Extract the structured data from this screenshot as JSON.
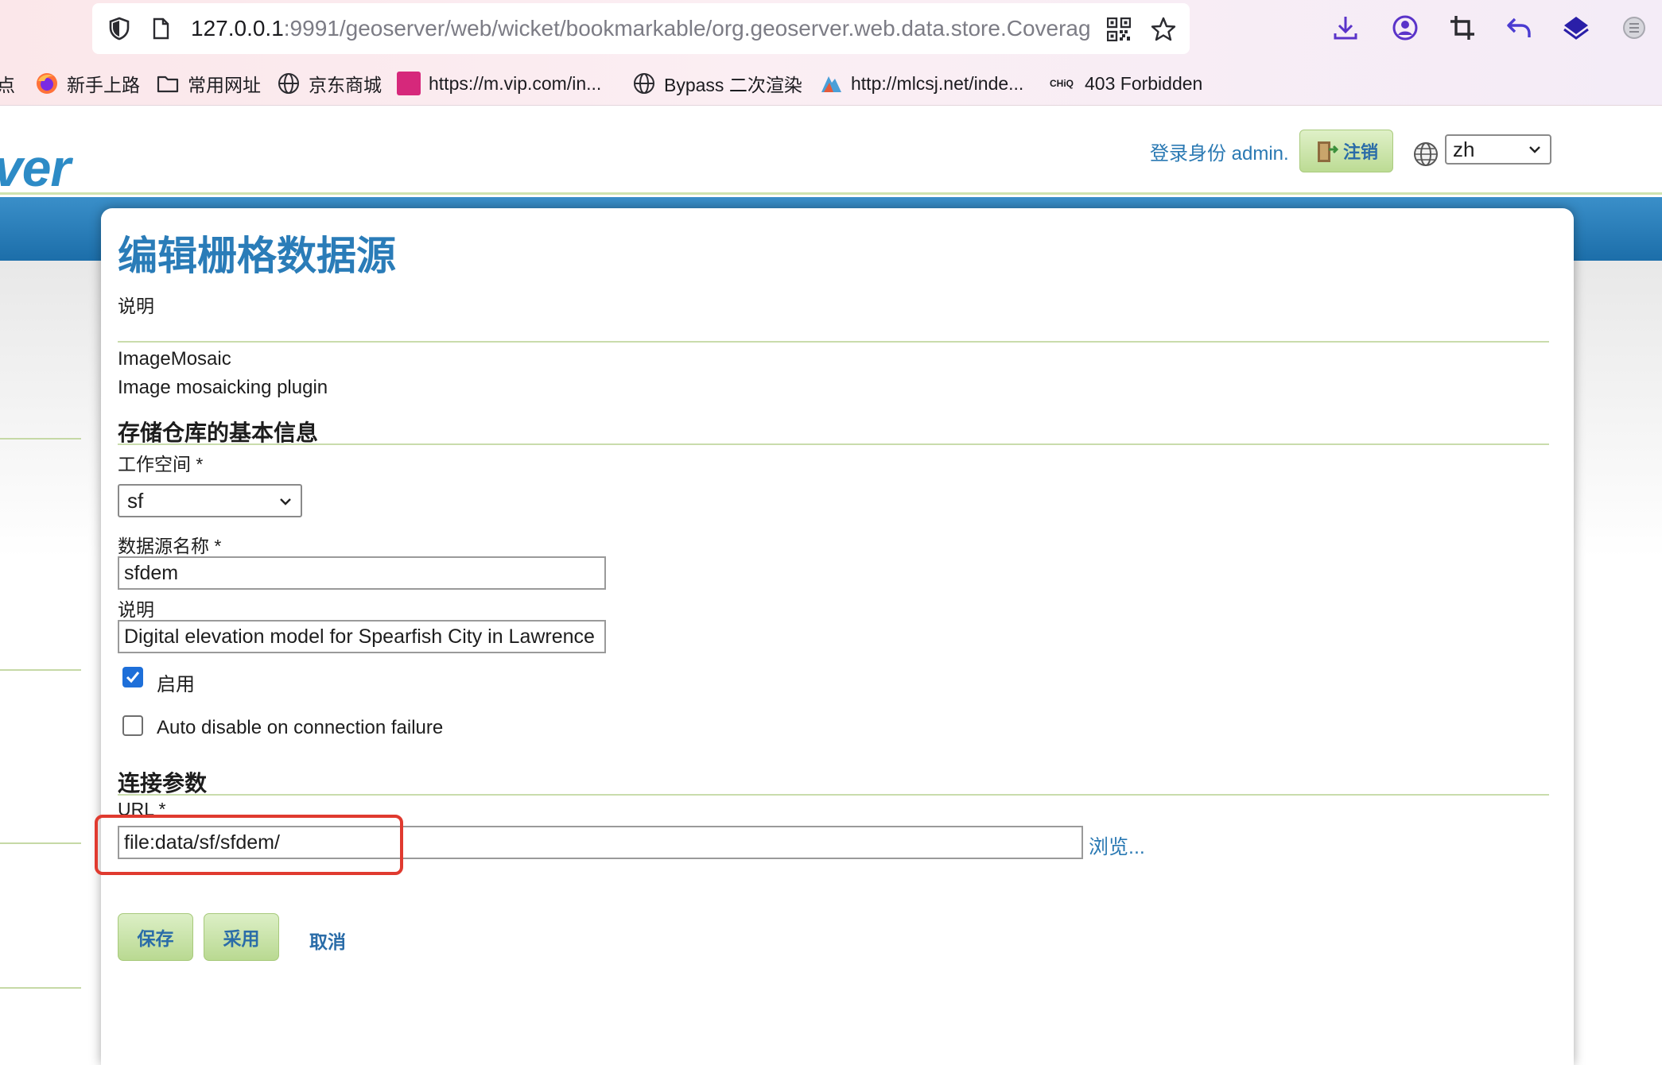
{
  "browser": {
    "url_host": "127.0.0.1",
    "url_rest": ":9991/geoserver/web/wicket/bookmarkable/org.geoserver.web.data.store.Coverag",
    "bookmarks": [
      {
        "label": "点",
        "icon": "none"
      },
      {
        "label": "新手上路",
        "icon": "firefox-icon"
      },
      {
        "label": "常用网址",
        "icon": "folder-icon"
      },
      {
        "label": "京东商城",
        "icon": "globe-icon"
      },
      {
        "label": "https://m.vip.com/in...",
        "icon": "vip-icon"
      },
      {
        "label": "Bypass 二次渲染",
        "icon": "globe-icon"
      },
      {
        "label": "http://mlcsj.net/inde...",
        "icon": "site-icon"
      },
      {
        "label": "403 Forbidden",
        "icon": "chiq-icon"
      }
    ],
    "chiq_text": "CHiQ"
  },
  "header": {
    "logo_text": "ver",
    "login_text": "登录身份 admin.",
    "logout_label": "注销",
    "language_value": "zh"
  },
  "page": {
    "title": "编辑栅格数据源",
    "description_label": "说明",
    "store_type": "ImageMosaic",
    "store_type_description": "Image mosaicking plugin",
    "basic_info_title": "存储仓库的基本信息",
    "workspace_label": "工作空间 *",
    "workspace_value": "sf",
    "datasource_name_label": "数据源名称 *",
    "datasource_name_value": "sfdem",
    "description_field_label": "说明",
    "description_field_value": "Digital elevation model for Spearfish City in Lawrence",
    "enabled_label": "启用",
    "enabled_checked": true,
    "auto_disable_label": "Auto disable on connection failure",
    "auto_disable_checked": false,
    "connection_params_title": "连接参数",
    "url_label": "URL *",
    "url_value": "file:data/sf/sfdem/",
    "browse_label": "浏览...",
    "save_label": "保存",
    "apply_label": "采用",
    "cancel_label": "取消"
  },
  "colors": {
    "accent_blue": "#2a79b3",
    "button_green": "#bcdb94",
    "highlight_red": "#e03a2f",
    "checkbox_blue": "#1e6fd9"
  }
}
